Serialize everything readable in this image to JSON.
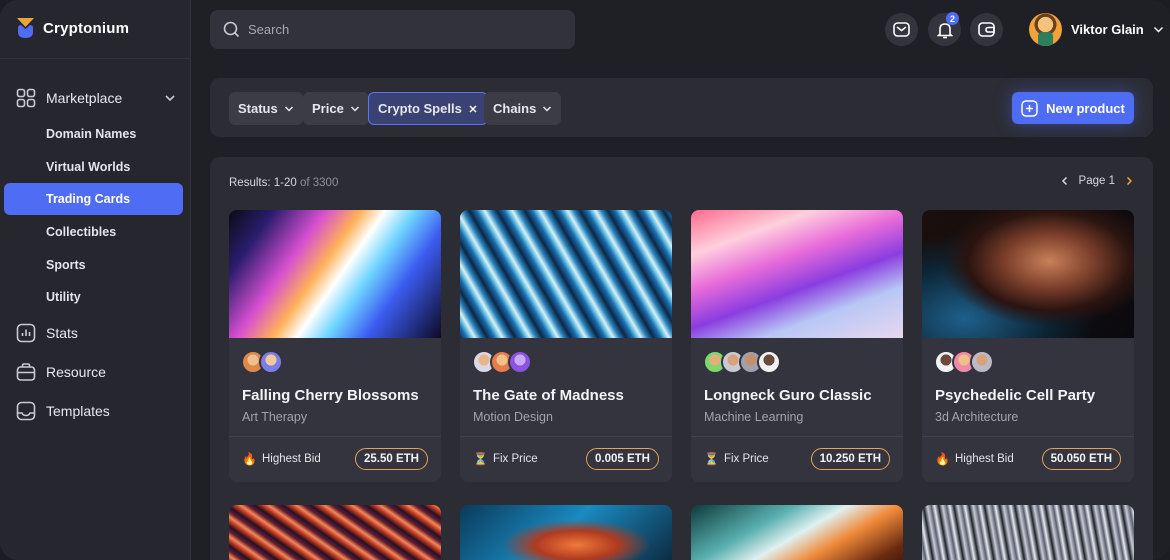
{
  "app": {
    "name": "Cryptonium"
  },
  "sidebar": {
    "main_item": {
      "label": "Marketplace",
      "icon": "grid-icon"
    },
    "sub_items": [
      {
        "label": "Domain Names",
        "active": false
      },
      {
        "label": "Virtual Worlds",
        "active": false
      },
      {
        "label": "Trading Cards",
        "active": true
      },
      {
        "label": "Collectibles",
        "active": false
      },
      {
        "label": "Sports",
        "active": false
      },
      {
        "label": "Utility",
        "active": false
      }
    ],
    "items": [
      {
        "label": "Stats",
        "icon": "stats-icon"
      },
      {
        "label": "Resource",
        "icon": "resource-icon"
      },
      {
        "label": "Templates",
        "icon": "templates-icon"
      }
    ]
  },
  "header": {
    "search_placeholder": "Search",
    "notification_count": "2",
    "user_name": "Viktor Glain"
  },
  "filters": {
    "chips": [
      {
        "label": "Status"
      },
      {
        "label": "Price"
      },
      {
        "label": "Crypto Spells"
      },
      {
        "label": "Chains"
      }
    ],
    "new_product_label": "New product"
  },
  "results": {
    "count_label": "Results: 1-20",
    "count_total": "of 3300",
    "page_label": "Page 1"
  },
  "cards": [
    {
      "title": "Falling Cherry Blossoms",
      "subtitle": "Art Therapy",
      "bid_type": "Highest Bid",
      "bid_icon": "fire-icon",
      "price": "25.50 ETH"
    },
    {
      "title": "The Gate of Madness",
      "subtitle": "Motion Design",
      "bid_type": "Fix Price",
      "bid_icon": "hourglass-icon",
      "price": "0.005 ETH"
    },
    {
      "title": "Longneck Guro Classic",
      "subtitle": "Machine Learning",
      "bid_type": "Fix Price",
      "bid_icon": "hourglass-icon",
      "price": "10.250 ETH"
    },
    {
      "title": "Psychedelic Cell Party",
      "subtitle": "3d Architecture",
      "bid_type": "Highest Bid",
      "bid_icon": "fire-icon",
      "price": "50.050 ETH"
    }
  ],
  "colors": {
    "accent": "#4f6cf5",
    "price_border": "#e3a35a",
    "background": "#1f2026"
  }
}
